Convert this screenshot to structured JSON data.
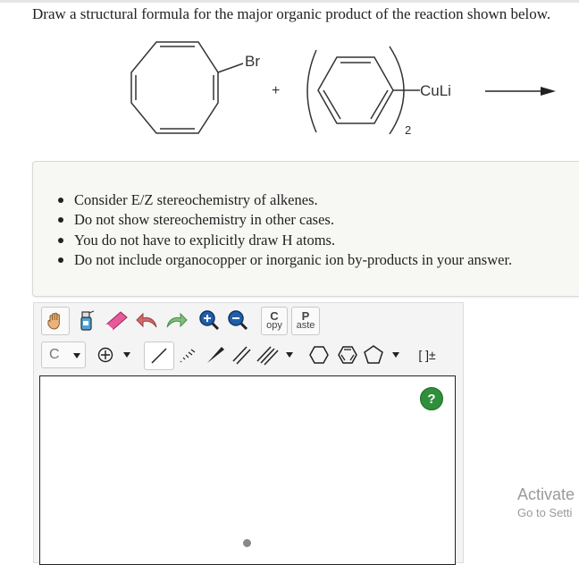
{
  "question": "Draw a structural formula for the major organic product of the reaction shown below.",
  "reaction": {
    "reactant1_substituent": "Br",
    "plus": "+",
    "reactant2_metal": "CuLi",
    "reactant2_subscript": "2"
  },
  "instructions": [
    "Consider E/Z stereochemistry of alkenes.",
    "Do not show stereochemistry in other cases.",
    "You do not have to explicitly draw H atoms.",
    "Do not include organocopper or inorganic ion by-products in your answer."
  ],
  "toolbar": {
    "row1": [
      "hand-tool-icon",
      "erase-all-icon",
      "eraser-icon",
      "undo-icon",
      "redo-icon",
      "zoom-in-icon",
      "zoom-out-icon"
    ],
    "copy_top": "C",
    "copy_bottom": "opy",
    "paste_top": "P",
    "paste_bottom": "aste",
    "element": "C",
    "charge": "[ ]±"
  },
  "help_label": "?",
  "watermark": {
    "line1": "Activate",
    "line2": "Go to Setti"
  },
  "colors": {
    "help_green": "#2f8f3a",
    "notes_bg": "#f7f7f4",
    "zoom_blue": "#1f5fa8",
    "eraser_pink": "#e8589a",
    "undo_red": "#d06a6a",
    "redo_green": "#7cbf7c"
  }
}
